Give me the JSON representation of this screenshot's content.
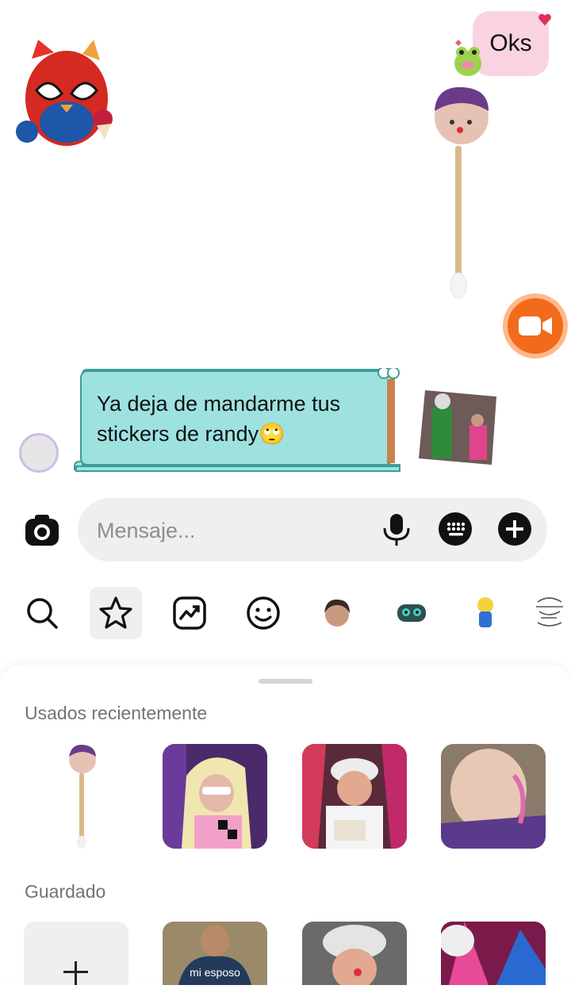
{
  "chat": {
    "outgoing_message": "Oks",
    "incoming_message": "Ya deja de mandarme tus stickers de randy🙄"
  },
  "composer": {
    "placeholder": "Mensaje..."
  },
  "sticker_tabs": [
    {
      "name": "search-icon"
    },
    {
      "name": "star-icon",
      "active": true
    },
    {
      "name": "trending-icon"
    },
    {
      "name": "emoji-icon"
    },
    {
      "name": "sticker-pack-face"
    },
    {
      "name": "sticker-pack-creature"
    },
    {
      "name": "sticker-pack-character"
    },
    {
      "name": "sticker-pack-sketch"
    }
  ],
  "sheet": {
    "recent_title": "Usados recientemente",
    "saved_title": "Guardado",
    "saved_caption": "mi esposo"
  },
  "colors": {
    "outgoing_bubble": "#f9d3e2",
    "incoming_bubble": "#9ee2e0",
    "video_button": "#f26a1b"
  }
}
